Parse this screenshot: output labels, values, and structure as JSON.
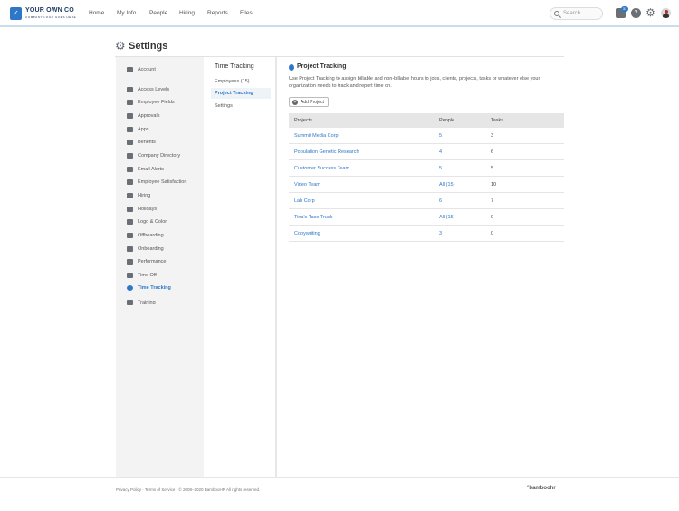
{
  "brand": {
    "name": "YOUR OWN CO",
    "tagline": "COMPANY LOGO GOES HERE"
  },
  "nav": [
    "Home",
    "My Info",
    "People",
    "Hiring",
    "Reports",
    "Files"
  ],
  "search": {
    "placeholder": "Search..."
  },
  "inbox_count": "33",
  "help_label": "?",
  "page_title": "Settings",
  "sidebar": {
    "items": [
      {
        "label": "Account",
        "icon": "wrench-icon"
      },
      {
        "label": "Access Levels",
        "icon": "lock-icon"
      },
      {
        "label": "Employee Fields",
        "icon": "fields-icon"
      },
      {
        "label": "Approvals",
        "icon": "thumbs-up-icon"
      },
      {
        "label": "Apps",
        "icon": "cloud-icon"
      },
      {
        "label": "Benefits",
        "icon": "heart-icon"
      },
      {
        "label": "Company Directory",
        "icon": "directory-icon"
      },
      {
        "label": "Email Alerts",
        "icon": "email-icon"
      },
      {
        "label": "Employee Satisfaction",
        "icon": "smile-icon"
      },
      {
        "label": "Hiring",
        "icon": "hiring-icon"
      },
      {
        "label": "Holidays",
        "icon": "calendar-icon"
      },
      {
        "label": "Logo & Color",
        "icon": "palette-icon"
      },
      {
        "label": "Offboarding",
        "icon": "offboarding-icon"
      },
      {
        "label": "Onboarding",
        "icon": "onboarding-icon"
      },
      {
        "label": "Performance",
        "icon": "performance-icon"
      },
      {
        "label": "Time Off",
        "icon": "plane-icon"
      },
      {
        "label": "Time Tracking",
        "icon": "clock-icon"
      },
      {
        "label": "Training",
        "icon": "graduation-icon"
      }
    ],
    "active_index": 16
  },
  "subnav": {
    "title": "Time Tracking",
    "items": [
      "Employees (15)",
      "Project Tracking",
      "Settings"
    ],
    "active_index": 1
  },
  "main": {
    "title": "Project Tracking",
    "description": "Use Project Tracking to assign billable and non-billable hours to jobs, clients, projects, tasks or whatever else your organization needs to track and report time on.",
    "add_button": "Add Project"
  },
  "table": {
    "headers": [
      "Projects",
      "People",
      "Tasks"
    ],
    "rows": [
      {
        "project": "Summit Media Corp",
        "people": "5",
        "tasks": "3"
      },
      {
        "project": "Population Genetic Research",
        "people": "4",
        "tasks": "6"
      },
      {
        "project": "Customer Success Team",
        "people": "5",
        "tasks": "5"
      },
      {
        "project": "Video Team",
        "people": "All (15)",
        "tasks": "10"
      },
      {
        "project": "Lab Corp",
        "people": "6",
        "tasks": "7"
      },
      {
        "project": "Tina's Taco Truck",
        "people": "All (15)",
        "tasks": "0"
      },
      {
        "project": "Copywriting",
        "people": "3",
        "tasks": "0"
      }
    ]
  },
  "footer": {
    "text": "Privacy Policy  ·  Terms of Service  ·  © 2008–2020 BambooHR All rights reserved.",
    "logo": "°bamboohr"
  },
  "colors": {
    "accent": "#2e77c8",
    "sidebar_bg": "#f3f3f3",
    "table_header_bg": "#e6e6e6"
  }
}
